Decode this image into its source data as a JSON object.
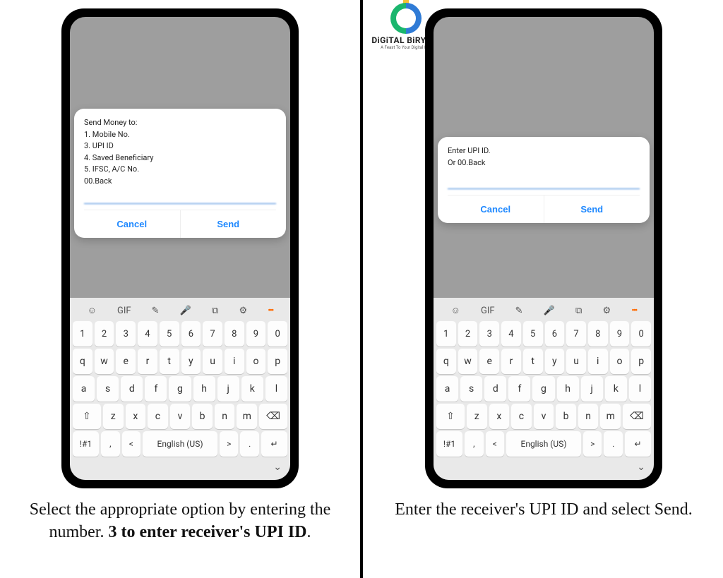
{
  "logo": {
    "title": "DiGiTAL BiRYANi",
    "tag": "A Feast To Your Digital Life"
  },
  "left": {
    "dialog_text": "Send Money to:\n1. Mobile No.\n3. UPI ID\n4. Saved Beneficiary\n5. IFSC, A/C No.\n00.Back",
    "input_value": "",
    "cancel": "Cancel",
    "send": "Send",
    "caption_plain": "Select the appropriate option by entering the number. ",
    "caption_bold": "3 to enter receiver's UPI ID",
    "caption_tail": "."
  },
  "right": {
    "dialog_text": "Enter UPI ID.\nOr 00.Back",
    "input_value": "",
    "cancel": "Cancel",
    "send": "Send",
    "caption_plain": "Enter the receiver's UPI ID  and select Send.",
    "caption_bold": "",
    "caption_tail": ""
  },
  "keyboard": {
    "toolbar": [
      "☺",
      "GIF",
      "✎",
      "🎤",
      "⧉",
      "⚙",
      "•••"
    ],
    "row_nums": [
      "1",
      "2",
      "3",
      "4",
      "5",
      "6",
      "7",
      "8",
      "9",
      "0"
    ],
    "row_q": [
      "q",
      "w",
      "e",
      "r",
      "t",
      "y",
      "u",
      "i",
      "o",
      "p"
    ],
    "row_a": [
      "a",
      "s",
      "d",
      "f",
      "g",
      "h",
      "j",
      "k",
      "l"
    ],
    "row_z": [
      "⇧",
      "z",
      "x",
      "c",
      "v",
      "b",
      "n",
      "m",
      "⌫"
    ],
    "row_space": [
      "!#1",
      ",",
      "<",
      "English (US)",
      ">",
      ".",
      "↵"
    ],
    "collapse": "⌄"
  }
}
